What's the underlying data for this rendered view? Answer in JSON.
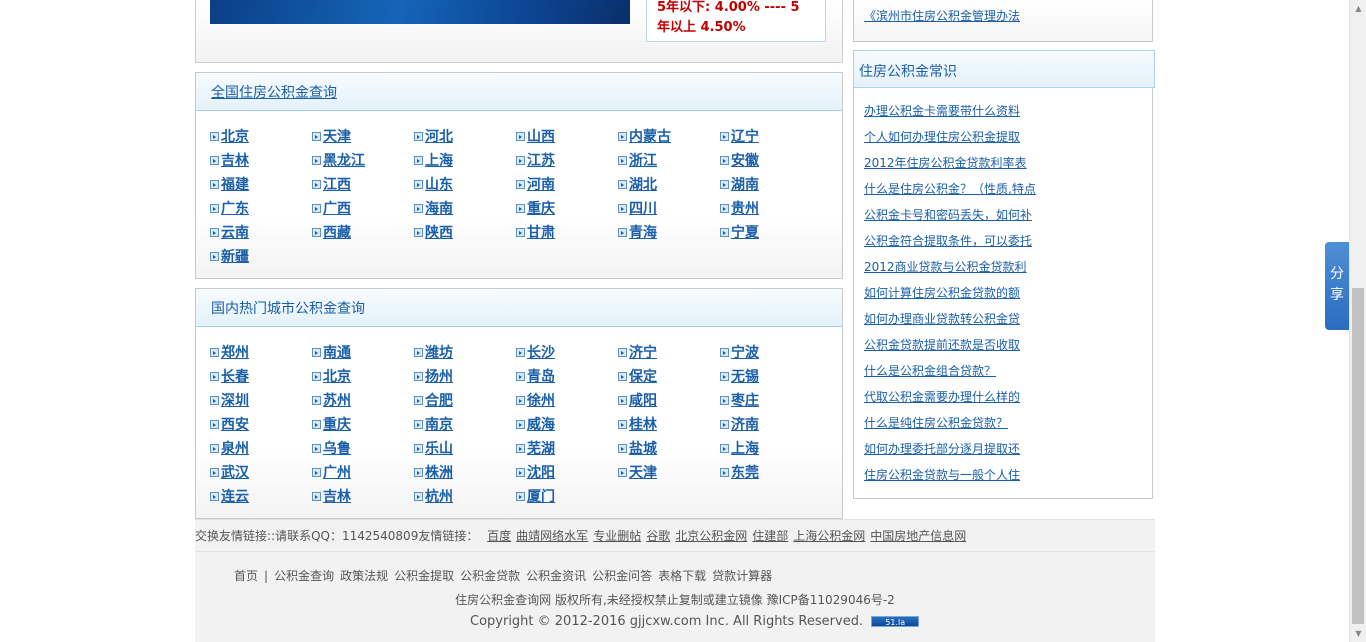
{
  "rates": {
    "line1": "5年以下: 4.00% ---- 5",
    "line2": "年以上 4.50%"
  },
  "side_top_link": "《滨州市住房公积金管理办法",
  "national": {
    "title": "全国住房公积金查询",
    "items": [
      "北京",
      "天津",
      "河北",
      "山西",
      "内蒙古",
      "辽宁",
      "吉林",
      "黑龙江",
      "上海",
      "江苏",
      "浙江",
      "安徽",
      "福建",
      "江西",
      "山东",
      "河南",
      "湖北",
      "湖南",
      "广东",
      "广西",
      "海南",
      "重庆",
      "四川",
      "贵州",
      "云南",
      "西藏",
      "陕西",
      "甘肃",
      "青海",
      "宁夏",
      "新疆"
    ]
  },
  "hot_cities": {
    "title": "国内热门城市公积金查询",
    "items": [
      "郑州",
      "南通",
      "潍坊",
      "长沙",
      "济宁",
      "宁波",
      "长春",
      "北京",
      "扬州",
      "青岛",
      "保定",
      "无锡",
      "深圳",
      "苏州",
      "合肥",
      "徐州",
      "咸阳",
      "枣庄",
      "西安",
      "重庆",
      "南京",
      "威海",
      "桂林",
      "济南",
      "泉州",
      "乌鲁",
      "乐山",
      "芜湖",
      "盐城",
      "上海",
      "武汉",
      "广州",
      "株洲",
      "沈阳",
      "天津",
      "东莞",
      "连云",
      "吉林",
      "杭州",
      "厦门"
    ]
  },
  "knowledge": {
    "title": "住房公积金常识",
    "items": [
      "办理公积金卡需要带什么资料",
      "个人如何办理住房公积金提取",
      "2012年住房公积金贷款利率表",
      "什么是住房公积金？（性质,特点",
      "公积金卡号和密码丢失，如何补",
      "公积金符合提取条件，可以委托",
      "2012商业贷款与公积金贷款利",
      "如何计算住房公积金贷款的额",
      "如何办理商业贷款转公积金贷",
      "公积金贷款提前还款是否收取",
      "什么是公积金组合贷款？",
      "代取公积金需要办理什么样的",
      "什么是纯住房公积金贷款？",
      "如何办理委托部分逐月提取还",
      "住房公积金贷款与一般个人住"
    ]
  },
  "friend_links": {
    "label": "交换友情链接::请联系QQ：1142540809友情链接：",
    "items": [
      "百度",
      "曲靖网络水军",
      "专业删帖",
      "谷歌",
      "北京公积金网",
      "住建部",
      "上海公积金网",
      "中国房地产信息网"
    ]
  },
  "footer": {
    "nav": [
      "首页",
      "公积金查询",
      "政策法规",
      "公积金提取",
      "公积金贷款",
      "公积金资讯",
      "公积金问答",
      "表格下载",
      "贷款计算器"
    ],
    "nav_sep": "|",
    "line1": "住房公积金查询网 版权所有,未经授权禁止复制或建立镜像 豫ICP备11029046号-2",
    "line2": "Copyright © 2012-2016 gjjcxw.com Inc. All Rights Reserved.",
    "badge": "51.la"
  },
  "share_label_1": "分",
  "share_label_2": "享"
}
